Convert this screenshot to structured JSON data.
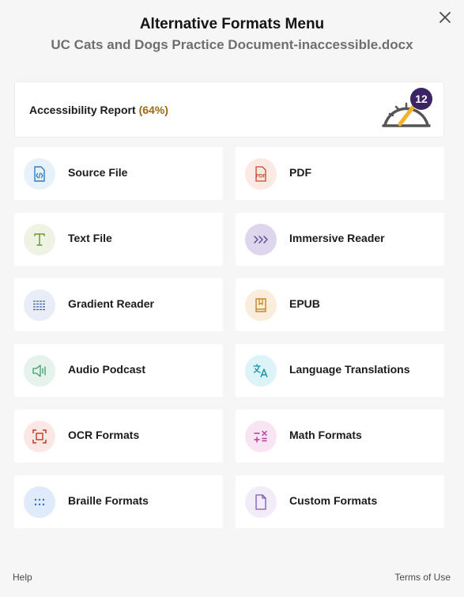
{
  "header": {
    "title": "Alternative Formats Menu",
    "subtitle": "UC Cats and Dogs Practice Document-inaccessible.docx",
    "close_icon": "close-icon"
  },
  "report": {
    "label": "Accessibility Report",
    "percent": "(64%)",
    "score_percent": 64,
    "badge": "12",
    "icon": "gauge-icon"
  },
  "formats": [
    {
      "label": "Source File",
      "icon": "code-file-icon",
      "color": "#2f7fc1",
      "bg": "#e7f1fa"
    },
    {
      "label": "PDF",
      "icon": "pdf-icon",
      "color": "#c9472b",
      "bg": "#fbe9e4"
    },
    {
      "label": "Text File",
      "icon": "text-icon",
      "color": "#6f9a2a",
      "bg": "#eef3e3"
    },
    {
      "label": "Immersive Reader",
      "icon": "immersive-reader-icon",
      "color": "#5b4a91",
      "bg": "#ddd6ec"
    },
    {
      "label": "Gradient Reader",
      "icon": "gradient-lines-icon",
      "color": "#3b62a8",
      "bg": "#e8edf7"
    },
    {
      "label": "EPUB",
      "icon": "book-icon",
      "color": "#c6862a",
      "bg": "#fbeddb"
    },
    {
      "label": "Audio Podcast",
      "icon": "speaker-icon",
      "color": "#3f9a66",
      "bg": "#e6f3ec"
    },
    {
      "label": "Language Translations",
      "icon": "translate-icon",
      "color": "#1c8fa8",
      "bg": "#dcf3f8"
    },
    {
      "label": "OCR Formats",
      "icon": "ocr-scan-icon",
      "color": "#c0392b",
      "bg": "#fbe7e4"
    },
    {
      "label": "Math Formats",
      "icon": "math-symbols-icon",
      "color": "#b03a9a",
      "bg": "#f9e4f4"
    },
    {
      "label": "Braille Formats",
      "icon": "braille-dots-icon",
      "color": "#2f6fc1",
      "bg": "#dfeafb"
    },
    {
      "label": "Custom Formats",
      "icon": "document-icon",
      "color": "#7a55b8",
      "bg": "#f1ecf8"
    }
  ],
  "footer": {
    "help": "Help",
    "terms": "Terms of Use"
  }
}
